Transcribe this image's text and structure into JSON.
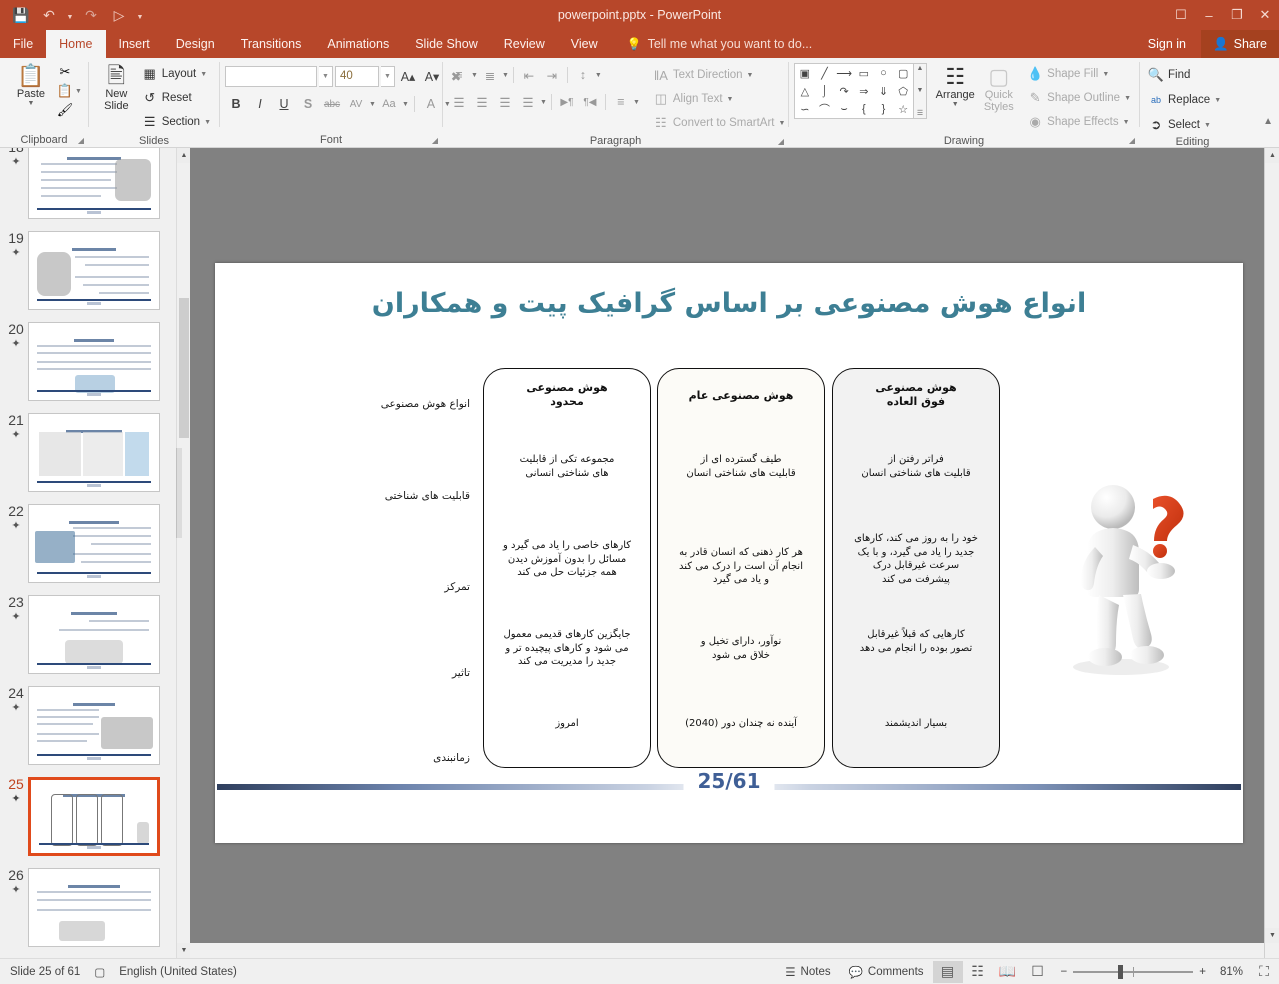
{
  "window": {
    "title": "powerpoint.pptx - PowerPoint",
    "qat": [
      "save-icon",
      "undo-icon",
      "redo-icon",
      "start-presentation-icon",
      "customize-qat-icon"
    ],
    "controls": [
      "ribbon-display-options",
      "minimize",
      "restore",
      "close"
    ]
  },
  "tabs": [
    {
      "label": "File",
      "active": false
    },
    {
      "label": "Home",
      "active": true
    },
    {
      "label": "Insert",
      "active": false
    },
    {
      "label": "Design",
      "active": false
    },
    {
      "label": "Transitions",
      "active": false
    },
    {
      "label": "Animations",
      "active": false
    },
    {
      "label": "Slide Show",
      "active": false
    },
    {
      "label": "Review",
      "active": false
    },
    {
      "label": "View",
      "active": false
    }
  ],
  "tellme": {
    "placeholder": "Tell me what you want to do..."
  },
  "account": {
    "signin": "Sign in",
    "share": "Share"
  },
  "ribbon": {
    "clipboard": {
      "label": "Clipboard",
      "paste": "Paste",
      "cut": "cut-icon",
      "copy": "copy-icon",
      "format_painter": "format-painter-icon"
    },
    "slides": {
      "label": "Slides",
      "new_slide": "New\nSlide",
      "new_slide_line1": "New",
      "new_slide_line2": "Slide",
      "layout": "Layout",
      "reset": "Reset",
      "section": "Section"
    },
    "font": {
      "label": "Font",
      "font_name": "",
      "font_size": "40",
      "grow": "A",
      "shrink": "A",
      "clear_formatting": "clear-formatting-icon",
      "bold": "B",
      "italic": "I",
      "underline": "U",
      "shadow": "S",
      "strikethrough": "abc",
      "char_spacing": "AV",
      "change_case": "Aa",
      "font_color": "A"
    },
    "paragraph": {
      "label": "Paragraph",
      "text_direction": "Text Direction",
      "align_text": "Align Text",
      "convert_smartart": "Convert to SmartArt"
    },
    "drawing": {
      "label": "Drawing",
      "arrange": "Arrange",
      "quick_styles_line1": "Quick",
      "quick_styles_line2": "Styles",
      "shape_fill": "Shape Fill",
      "shape_outline": "Shape Outline",
      "shape_effects": "Shape Effects",
      "shapes": [
        "text-box",
        "line",
        "arrow",
        "rectangle",
        "oval",
        "rounded-rectangle",
        "triangle",
        "elbow-connector",
        "elbow-arrow-connector",
        "right-arrow",
        "down-arrow",
        "pentagon-tag",
        "scribble",
        "curve",
        "arc",
        "left-brace",
        "right-brace",
        "star"
      ]
    },
    "editing": {
      "label": "Editing",
      "find": "Find",
      "replace": "Replace",
      "select": "Select"
    }
  },
  "slide_panel": {
    "thumbnails": [
      {
        "num": "18",
        "starred": true,
        "selected": false,
        "kind": "text-image-right"
      },
      {
        "num": "19",
        "starred": true,
        "selected": false,
        "kind": "text-image-left"
      },
      {
        "num": "20",
        "starred": true,
        "selected": false,
        "kind": "text-image-center"
      },
      {
        "num": "21",
        "starred": true,
        "selected": false,
        "kind": "table"
      },
      {
        "num": "22",
        "starred": true,
        "selected": false,
        "kind": "text-image-left"
      },
      {
        "num": "23",
        "starred": true,
        "selected": false,
        "kind": "text-image-center"
      },
      {
        "num": "24",
        "starred": true,
        "selected": false,
        "kind": "text-image-center"
      },
      {
        "num": "25",
        "starred": true,
        "selected": true,
        "kind": "cards"
      },
      {
        "num": "26",
        "starred": true,
        "selected": false,
        "kind": "text-image-center"
      }
    ]
  },
  "slide": {
    "title": "انواع هوش مصنوعی بر اساس گرافیک پیت و همکاران",
    "title_color": "#3d7f94",
    "row_labels": [
      "انواع هوش مصنوعی",
      "قابلیت های شناختی",
      "تمرکز",
      "تاثیر",
      "زمانبندی"
    ],
    "columns": [
      {
        "id": "narrow-ai",
        "bg": "#ffffff",
        "cells": [
          "هوش مصنوعی\nمحدود",
          "مجموعه تکی از قابلیت\nهای شناختی انسانی",
          "کارهای خاصی را یاد می گیرد و\nمسائل را بدون آموزش دیدن\nهمه جزئیات حل می کند",
          "جایگزین کارهای قدیمی معمول\nمی شود و کارهای پیچیده تر و\nجدید را مدیریت می کند",
          "امروز"
        ]
      },
      {
        "id": "general-ai",
        "bg": "#fcfbf7",
        "cells": [
          "هوش مصنوعی عام",
          "طیف گسترده ای از\nقابلیت های شناختی انسان",
          "هر کار ذهنی که انسان قادر به\nانجام آن است را درک می کند\nو یاد می گیرد",
          "نوآور، دارای تخیل و\nخلاق می شود",
          "آینده نه چندان دور (2040)"
        ]
      },
      {
        "id": "super-ai",
        "bg": "#f2f2f2",
        "cells": [
          "هوش مصنوعی\nفوق العاده",
          "فراتر رفتن از\nقابلیت های شناختی انسان",
          "خود را به روز می کند، کارهای\nجدید را یاد می گیرد، و با یک\nسرعت غیرقابل درک\nپیشرفت می کند",
          "کارهایی که قبلاً غیرقابل\nتصور بوده را انجام می دهد",
          "بسیار اندیشمند"
        ]
      }
    ],
    "footer_number": "25/61",
    "image": "3d-person-with-question-mark"
  },
  "statusbar": {
    "slide_of": "Slide 25 of 61",
    "language_icon": "spell-check-icon",
    "language": "English (United States)",
    "notes": "Notes",
    "comments": "Comments",
    "views": [
      "normal-view",
      "slide-sorter-view",
      "reading-view",
      "slide-show-view"
    ],
    "zoom": "81%",
    "zoom_minus": "−",
    "zoom_plus": "+",
    "fit_slide": "fit-slide-icon"
  }
}
